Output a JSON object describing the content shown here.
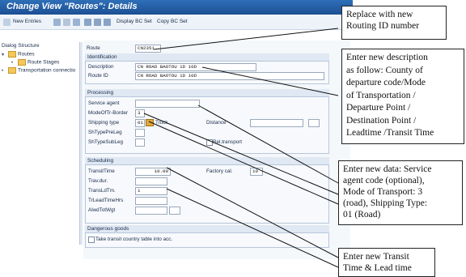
{
  "window": {
    "title": "Change View \"Routes\": Details"
  },
  "toolbar": {
    "new_entries": "New Entries",
    "display_bc_set": "Display BC Set",
    "copy_bc_set": "Copy BC Set"
  },
  "nav": {
    "header": "Dialog Structure",
    "items": [
      "Routes",
      "Route Stages",
      "Transportation connectio"
    ]
  },
  "route": {
    "route_label": "Route",
    "route_value": "CN2351",
    "identification_header": "Identification",
    "description_label": "Description",
    "description_value": "CN ROAD BAOTOU 1D 10D",
    "route_id_label": "Route ID",
    "route_id_value": "CN ROAD BAOTOU 1D 10D"
  },
  "processing": {
    "header": "Processing",
    "service_agent_label": "Service agent",
    "service_agent_value": "",
    "mode_label": "ModeOfTr-Border",
    "mode_value": "3",
    "shipping_type_label": "Shipping type",
    "shipping_type_value": "01",
    "shipping_type_desc": "Truck",
    "distance_label": "Distance",
    "sh_type_pre_label": "ShTypePreLeg",
    "sh_type_sub_label": "ShTypeSubLeg",
    "rel_transport_label": "Rel.transport"
  },
  "scheduling": {
    "header": "Scheduling",
    "transit_time_label": "TransitTime",
    "transit_time_value": "10.00",
    "factory_cal_label": "Factory cal.",
    "factory_cal_value": "10",
    "trav_dur_label": "Trav.dur.",
    "trans_ld_label": "TransLdTm.",
    "trans_ld_value": "1",
    "tr_lead_label": "TrLeadTimeHrs",
    "alwd_label": "AlwdTotWgt"
  },
  "dangerous_goods": {
    "header": "Dangerous goods",
    "checkbox_label": "Take transit country table into acc."
  },
  "callouts": {
    "routing_id": [
      "Replace with new",
      "Routing ID number"
    ],
    "description": [
      "Enter new description",
      "as follow: County of",
      "departure code/Mode",
      "of Transportation  /",
      "Departure Point /",
      "Destination Point /",
      "Leadtime  /Transit Time"
    ],
    "service": [
      "Enter new data: Service",
      "agent code (optional),",
      "Mode of Transport: 3",
      "(road), Shipping Type:",
      "01 (Road)"
    ],
    "transit": [
      "Enter new Transit",
      "Time & Lead time"
    ]
  },
  "colors": {
    "title_bar": "#1c4f93",
    "group_header": "#dfe8f3",
    "folder": "#f3c75a"
  }
}
